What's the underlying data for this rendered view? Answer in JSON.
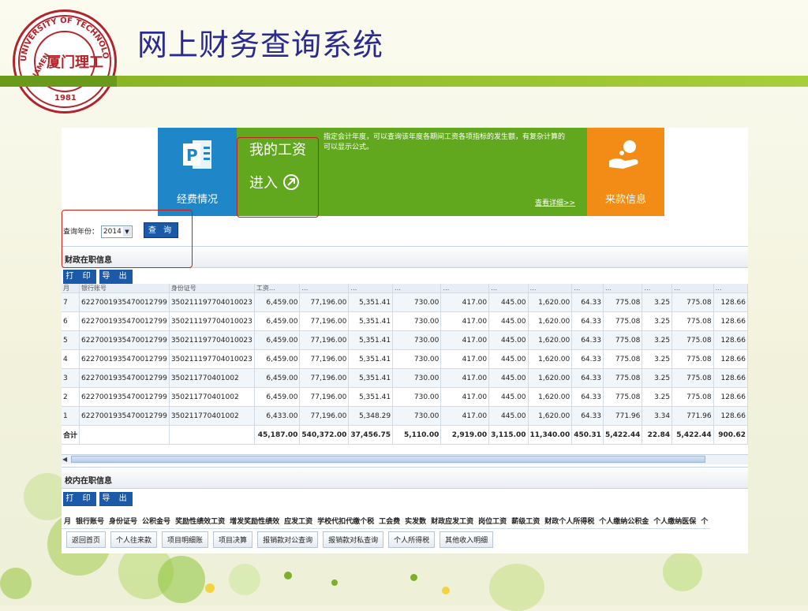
{
  "slide": {
    "title": "网上财务查询系统",
    "logo": {
      "top_text": "UNIVERSITY OF TECHNOLOGY",
      "side_text": "XIAMEN",
      "year": "1981",
      "center_text": "厦门理工"
    }
  },
  "banner": {
    "expense_label": "经费情况",
    "salary_title": "我的工资",
    "salary_enter": "进入",
    "description": "指定会计年度，可以查询该年度各期间工资各项指标的发生额，有复杂计算的可以显示公式。",
    "more_link": "查看详细>>",
    "income_label": "来款信息"
  },
  "query": {
    "year_label": "查询年份：",
    "year_value": "2014",
    "query_button": "查 询"
  },
  "section1": {
    "title": "财政在职信息",
    "print_button": "打 印",
    "export_button": "导 出",
    "header_hint": [
      "月",
      "银行账号",
      "身份证号",
      "工资…",
      "…",
      "…",
      "…",
      "…",
      "…",
      "…",
      "…",
      "…",
      "…",
      "…",
      "…",
      "…"
    ],
    "rows": [
      [
        "7",
        "6227001935470012799",
        "350211197704010023",
        "6,459.00",
        "77,196.00",
        "5,351.41",
        "730.00",
        "417.00",
        "445.00",
        "1,620.00",
        "64.33",
        "775.08",
        "3.25",
        "775.08",
        "128.66"
      ],
      [
        "6",
        "6227001935470012799",
        "350211197704010023",
        "6,459.00",
        "77,196.00",
        "5,351.41",
        "730.00",
        "417.00",
        "445.00",
        "1,620.00",
        "64.33",
        "775.08",
        "3.25",
        "775.08",
        "128.66"
      ],
      [
        "5",
        "6227001935470012799",
        "350211197704010023",
        "6,459.00",
        "77,196.00",
        "5,351.41",
        "730.00",
        "417.00",
        "445.00",
        "1,620.00",
        "64.33",
        "775.08",
        "3.25",
        "775.08",
        "128.66"
      ],
      [
        "4",
        "6227001935470012799",
        "350211197704010023",
        "6,459.00",
        "77,196.00",
        "5,351.41",
        "730.00",
        "417.00",
        "445.00",
        "1,620.00",
        "64.33",
        "775.08",
        "3.25",
        "775.08",
        "128.66"
      ],
      [
        "3",
        "6227001935470012799",
        "350211770401002",
        "6,459.00",
        "77,196.00",
        "5,351.41",
        "730.00",
        "417.00",
        "445.00",
        "1,620.00",
        "64.33",
        "775.08",
        "3.25",
        "775.08",
        "128.66"
      ],
      [
        "2",
        "6227001935470012799",
        "350211770401002",
        "6,459.00",
        "77,196.00",
        "5,351.41",
        "730.00",
        "417.00",
        "445.00",
        "1,620.00",
        "64.33",
        "775.08",
        "3.25",
        "775.08",
        "128.66"
      ],
      [
        "1",
        "6227001935470012799",
        "350211770401002",
        "6,433.00",
        "77,196.00",
        "5,348.29",
        "730.00",
        "417.00",
        "445.00",
        "1,620.00",
        "64.33",
        "771.96",
        "3.34",
        "771.96",
        "128.66"
      ]
    ],
    "total": [
      "合计",
      "",
      "",
      "45,187.00",
      "540,372.00",
      "37,456.75",
      "5,110.00",
      "2,919.00",
      "3,115.00",
      "11,340.00",
      "450.31",
      "5,422.44",
      "22.84",
      "5,422.44",
      "900.62"
    ]
  },
  "section2": {
    "title": "校内在职信息",
    "print_button": "打 印",
    "export_button": "导 出",
    "columns": [
      "月",
      "银行账号",
      "身份证号",
      "公积金号",
      "奖励性绩效工资",
      "增发奖励性绩效",
      "应发工资",
      "学校代扣代缴个税",
      "工会费",
      "实发数",
      "财政应发工资",
      "岗位工资",
      "薪级工资",
      "财政个人所得税",
      "个人缴纳公积金",
      "个人缴纳医保",
      "个"
    ]
  },
  "bottom_nav": [
    "返回首页",
    "个人往来款",
    "项目明细账",
    "项目决算",
    "报销款对公查询",
    "报销款对私查询",
    "个人所得税",
    "其他收入明细"
  ],
  "colors": {
    "title": "#2a2a90",
    "stripe": "#8ab525",
    "banner_blue": "#1f86c8",
    "banner_green": "#62a81e",
    "banner_orange": "#f28c16",
    "button_blue": "#1a5aa8",
    "highlight_red": "#c42020"
  }
}
